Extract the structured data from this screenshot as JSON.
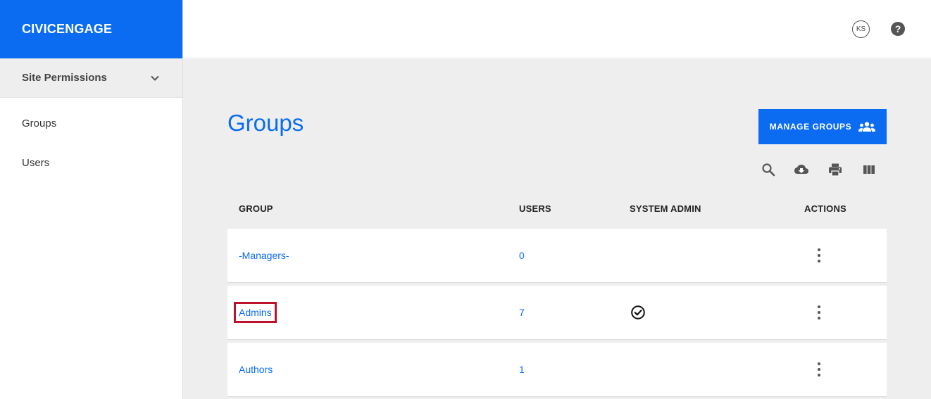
{
  "brand": "CIVICENGAGE",
  "sidebar": {
    "section": "Site Permissions",
    "items": [
      {
        "label": "Groups"
      },
      {
        "label": "Users"
      }
    ]
  },
  "header": {
    "avatar_initials": "KS",
    "help_label": "?"
  },
  "main": {
    "title": "Groups",
    "manage_button": "MANAGE GROUPS",
    "toolbar_icons": [
      "search-icon",
      "cloud-download-icon",
      "print-icon",
      "columns-icon"
    ],
    "columns": [
      "GROUP",
      "USERS",
      "SYSTEM ADMIN",
      "ACTIONS"
    ],
    "rows": [
      {
        "group": "-Managers-",
        "users": "0",
        "system_admin": false
      },
      {
        "group": "Admins",
        "users": "7",
        "system_admin": true
      },
      {
        "group": "Authors",
        "users": "1",
        "system_admin": false
      }
    ]
  },
  "colors": {
    "accent": "#0b6cf2",
    "highlight": "#c0112b",
    "background": "#eeeeee"
  }
}
